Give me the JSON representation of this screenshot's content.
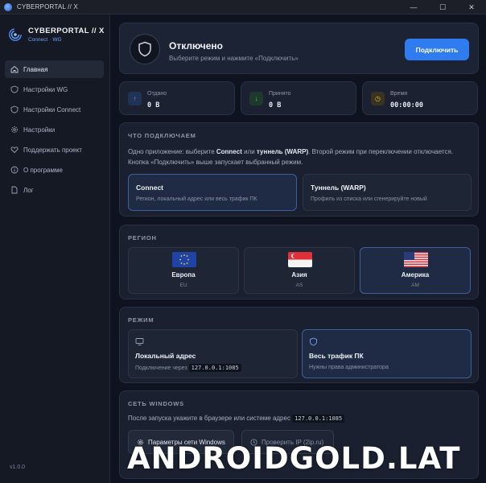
{
  "window": {
    "title": "CYBERPORTAL // X",
    "minimize": "—",
    "maximize": "☐",
    "close": "✕"
  },
  "brand": {
    "title": "CYBERPORTAL // X",
    "sub_a": "Connect",
    "sub_sep": "·",
    "sub_b": "WG"
  },
  "sidebar": {
    "items": [
      {
        "label": "Главная",
        "icon": "home-icon",
        "active": true
      },
      {
        "label": "Настройки WG",
        "icon": "shield-icon",
        "active": false
      },
      {
        "label": "Настройки Connect",
        "icon": "shield-icon",
        "active": false
      },
      {
        "label": "Настройки",
        "icon": "gear-icon",
        "active": false
      },
      {
        "label": "Поддержать проект",
        "icon": "heart-icon",
        "active": false
      },
      {
        "label": "О программе",
        "icon": "info-icon",
        "active": false
      },
      {
        "label": "Лог",
        "icon": "document-icon",
        "active": false
      }
    ],
    "version": "v1.0.0"
  },
  "status": {
    "title": "Отключено",
    "subtitle": "Выберите режим и нажмите «Подключить»",
    "button": "Подключить"
  },
  "stats": [
    {
      "label": "Отдано",
      "value": "0 B",
      "icon": "arrow-up-icon"
    },
    {
      "label": "Принято",
      "value": "0 B",
      "icon": "arrow-down-icon"
    },
    {
      "label": "Время",
      "value": "00:00:00",
      "icon": "clock-icon"
    }
  ],
  "what": {
    "heading": "ЧТО ПОДКЛЮЧАЕМ",
    "desc_1": "Одно приложение: выберите ",
    "desc_b1": "Connect",
    "desc_2": " или ",
    "desc_b2": "туннель (WARP)",
    "desc_3": ". Второй режим при переключении отключается. Кнопка «Подключить» выше запускает выбранный режим.",
    "options": [
      {
        "title": "Connect",
        "sub": "Регион, локальный адрес или весь трафик ПК",
        "selected": true
      },
      {
        "title": "Туннель (WARP)",
        "sub": "Профиль из списка или сгенерируйте новый",
        "selected": false
      }
    ]
  },
  "region": {
    "heading": "РЕГИОН",
    "items": [
      {
        "name": "Европа",
        "code": "EU",
        "flag": "eu-flag-icon",
        "selected": false
      },
      {
        "name": "Азия",
        "code": "AS",
        "flag": "singapore-flag-icon",
        "selected": false
      },
      {
        "name": "Америка",
        "code": "AM",
        "flag": "usa-flag-icon",
        "selected": true
      }
    ]
  },
  "mode": {
    "heading": "РЕЖИМ",
    "items": [
      {
        "title": "Локальный адрес",
        "sub_text": "Подключение через",
        "sub_code": "127.0.0.1:1085",
        "icon": "monitor-icon",
        "selected": false
      },
      {
        "title": "Весь трафик ПК",
        "sub_text": "Нужны права администратора",
        "sub_code": "",
        "icon": "shield-icon",
        "selected": true
      }
    ]
  },
  "network": {
    "heading": "СЕТЬ WINDOWS",
    "desc": "После запуска укажите в браузере или системе адрес",
    "code": "127.0.0.1:1085",
    "buttons": [
      {
        "label": "Параметры сети Windows",
        "icon": "gear-icon",
        "disabled": false
      },
      {
        "label": "Проверить IP (2ip.ru)",
        "icon": "clock-icon",
        "disabled": true
      }
    ]
  },
  "watermark": "ANDROIDGOLD.LAT",
  "colors": {
    "accent": "#2f7cf0",
    "background": "#0f1320",
    "card": "#1a2030",
    "selected_border": "#3f5f99"
  }
}
